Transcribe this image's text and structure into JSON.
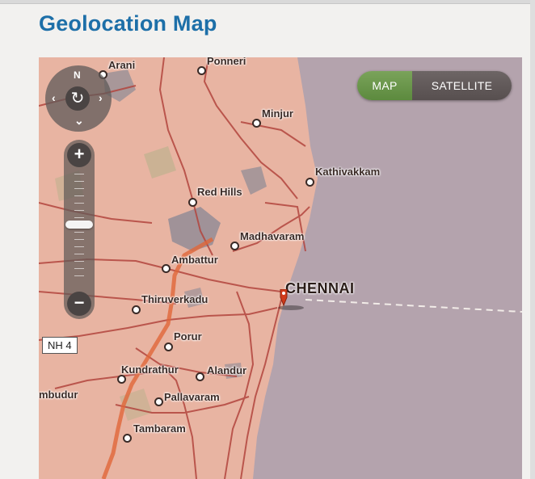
{
  "page": {
    "title": "Geolocation Map"
  },
  "map": {
    "type_toggle": {
      "map_label": "MAP",
      "satellite_label": "SATELLITE",
      "selected": "MAP"
    },
    "nav_control": {
      "north_label": "N"
    },
    "zoom": {
      "in_label": "+",
      "out_label": "−",
      "level_fraction": 0.6
    },
    "highway_shield": "NH 4",
    "marker": {
      "place": "CHENNAI",
      "color": "#d13a1a"
    },
    "places": [
      {
        "name": "Arani"
      },
      {
        "name": "Ponneri"
      },
      {
        "name": "Minjur"
      },
      {
        "name": "Kathivakkam"
      },
      {
        "name": "Red Hills"
      },
      {
        "name": "Madhavaram"
      },
      {
        "name": "Ambattur"
      },
      {
        "name": "CHENNAI"
      },
      {
        "name": "Thiruverkadu"
      },
      {
        "name": "Porur"
      },
      {
        "name": "Kundrathur"
      },
      {
        "name": "Alandur"
      },
      {
        "name": "mbudur"
      },
      {
        "name": "Pallavaram"
      },
      {
        "name": "Tambaram"
      }
    ],
    "colors": {
      "land": "#e8b4a2",
      "sea": "#b4a3ad",
      "water": "#8d8a96",
      "road": "#b2453e",
      "highway": "#e0663a"
    }
  }
}
